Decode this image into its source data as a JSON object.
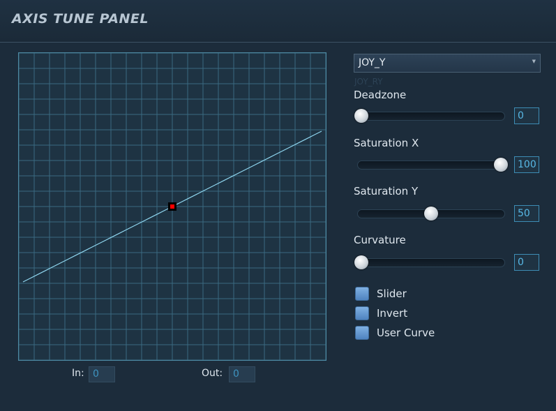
{
  "title": "AXIS TUNE PANEL",
  "axis_select": {
    "value": "JOY_Y",
    "ghost": "JOY_RY"
  },
  "sliders": [
    {
      "label": "Deadzone",
      "value": "0"
    },
    {
      "label": "Saturation X",
      "value": "100"
    },
    {
      "label": "Saturation Y",
      "value": "50"
    },
    {
      "label": "Curvature",
      "value": "0"
    }
  ],
  "checkboxes": [
    {
      "label": "Slider"
    },
    {
      "label": "Invert"
    },
    {
      "label": "User Curve"
    }
  ],
  "io": {
    "in_label": "In:",
    "in_value": "0",
    "out_label": "Out:",
    "out_value": "0"
  },
  "curve": {
    "deadzone": 0,
    "saturation_x": 100,
    "saturation_y": 50,
    "curvature": 0,
    "line_color": "#8fd6ef",
    "grid_color": "#3a6a80",
    "point_color": "#ff0000"
  }
}
